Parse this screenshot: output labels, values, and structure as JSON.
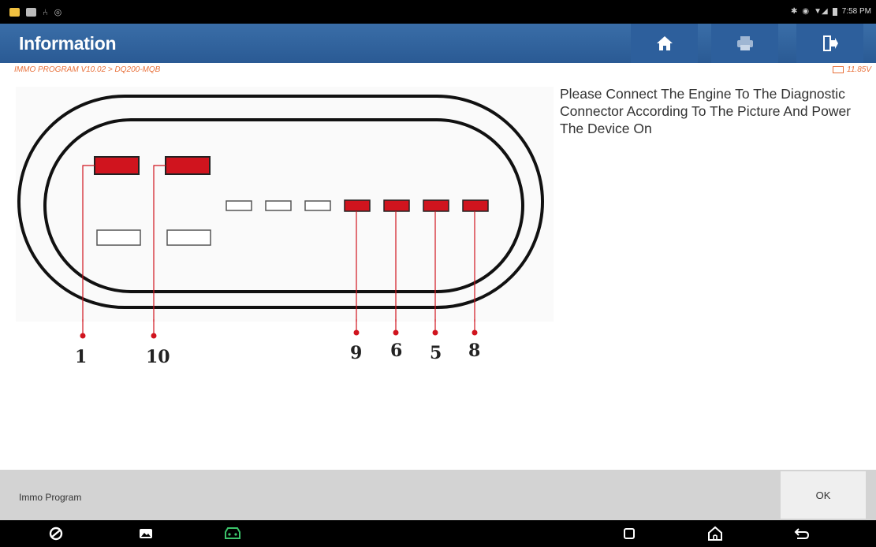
{
  "status_bar": {
    "time": "7:58 PM",
    "left_icons": [
      "notification-icon",
      "image-icon",
      "usb-icon",
      "settings-icon"
    ],
    "right_icons": [
      "bluetooth-icon",
      "wifi-icon",
      "signal-icon",
      "battery-icon"
    ]
  },
  "header": {
    "title": "Information",
    "buttons": [
      "home-icon",
      "print-icon",
      "exit-icon"
    ],
    "color": "#3a6ea8"
  },
  "breadcrumb": {
    "path": "IMMO PROGRAM V10.02 > DQ200-MQB",
    "voltage": "11.85V",
    "accent_color": "#e8703a"
  },
  "diagram": {
    "pin_labels": [
      "1",
      "10",
      "9",
      "6",
      "5",
      "8"
    ],
    "active_pin_color": "#d0141e"
  },
  "instruction": {
    "text": "Please Connect The Engine To The Diagnostic Connector According To The Picture And Power The Device On"
  },
  "footer": {
    "label": "Immo Program",
    "ok_label": "OK"
  },
  "nav_bar": {
    "icons": [
      "browser-icon",
      "gallery-icon",
      "car-diagnostic-icon",
      "recent-apps-icon",
      "home-nav-icon",
      "back-icon"
    ]
  }
}
